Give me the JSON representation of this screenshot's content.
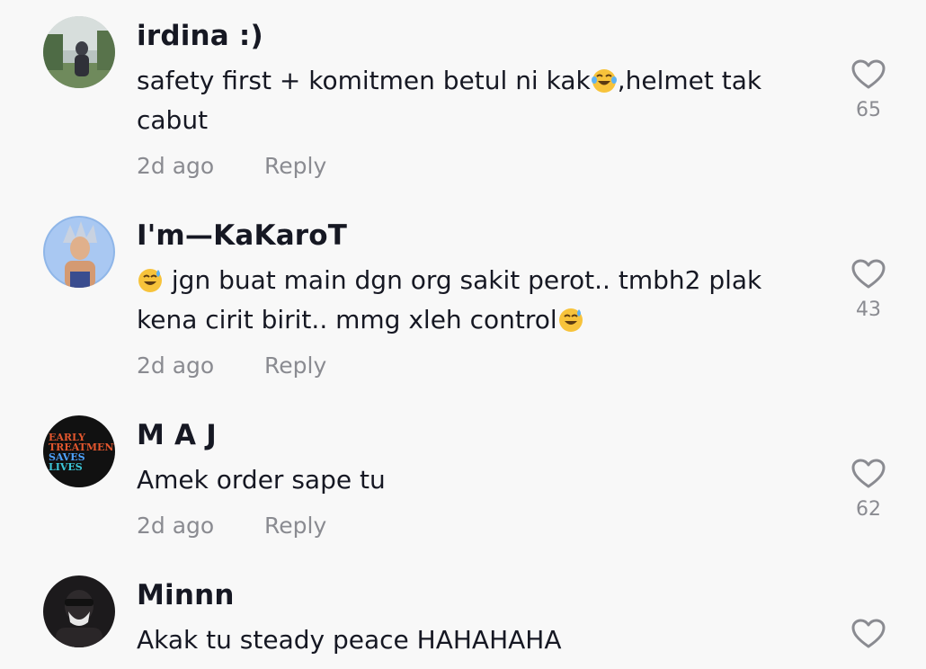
{
  "comments": [
    {
      "username": "irdina :)",
      "text_before": "safety first + komitmen betul ni kak",
      "emoji": "laughing-tears-emoji",
      "text_after": ",helmet tak cabut",
      "time": "2d ago",
      "reply": "Reply",
      "likes": "65"
    },
    {
      "username": "I'm—KaKaroT",
      "emoji_lead": "sweat-smile-emoji",
      "text_before": " jgn buat main dgn org sakit perot.. tmbh2 plak kena cirit birit.. mmg xleh control",
      "emoji": "sweat-smile-emoji",
      "time": "2d ago",
      "reply": "Reply",
      "likes": "43"
    },
    {
      "username": "M A J",
      "avatar_text": [
        "EARLY",
        "TREATMENT",
        "SAVES",
        "LIVES"
      ],
      "text": "Amek order sape tu",
      "time": "2d ago",
      "reply": "Reply",
      "likes": "62"
    },
    {
      "username": "Minnn",
      "text": "Akak tu steady peace HAHAHAHA"
    }
  ],
  "colors": {
    "background": "#f8f8f8",
    "text_primary": "#161823",
    "text_secondary": "#8a8b91"
  }
}
